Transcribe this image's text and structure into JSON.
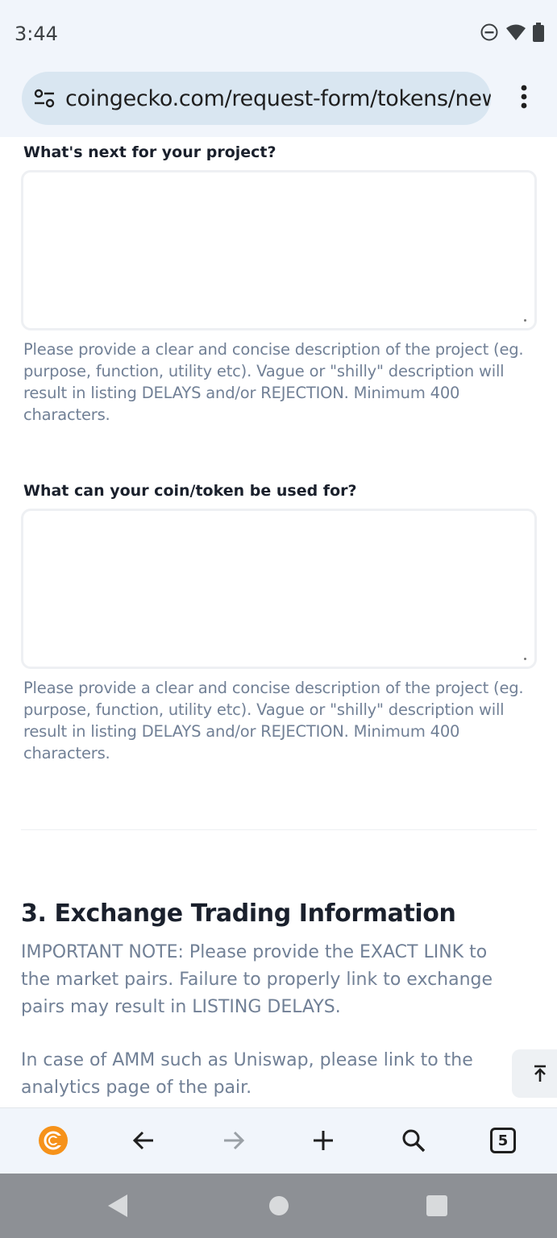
{
  "status_bar": {
    "time": "3:44"
  },
  "browser": {
    "url": "coingecko.com/request-form/tokens/new",
    "tab_count": "5"
  },
  "form": {
    "field1": {
      "label": "What's next for your project?",
      "value": "",
      "help_lines": [
        "Please provide a clear and concise description of the project (eg.",
        "purpose, function, utility etc). Vague or \"shilly\" description will",
        "result in listing DELAYS and/or REJECTION. Minimum 400",
        "characters."
      ]
    },
    "field2": {
      "label": "What can your coin/token be used for?",
      "value": "",
      "help_lines": [
        "Please provide a clear and concise description of the project (eg.",
        "purpose, function, utility etc). Vague or \"shilly\" description will",
        "result in listing DELAYS and/or REJECTION. Minimum 400",
        "characters."
      ]
    },
    "section3": {
      "title": "3. Exchange Trading Information",
      "note_lines": [
        "IMPORTANT NOTE: Please provide the EXACT LINK to",
        "the market pairs. Failure to properly link to exchange",
        "pairs may result in LISTING DELAYS."
      ],
      "amm_lines": [
        "In case of AMM such as Uniswap, please link to the",
        "analytics page of the pair."
      ]
    }
  },
  "icons": {
    "status": [
      "dnd-icon",
      "wifi-icon",
      "battery-icon"
    ],
    "toolbar": [
      "coingecko-logo-icon",
      "back-arrow-icon",
      "forward-arrow-icon",
      "new-tab-plus-icon",
      "search-icon",
      "tab-switcher-icon"
    ],
    "system_nav": [
      "nav-back-icon",
      "nav-home-icon",
      "nav-recents-icon"
    ]
  },
  "colors": {
    "brand": "#f6921a",
    "label": "#1a202c",
    "help_text": "#718096",
    "chrome_bg": "#f1f5fb",
    "url_pill": "#d9e6f1"
  }
}
